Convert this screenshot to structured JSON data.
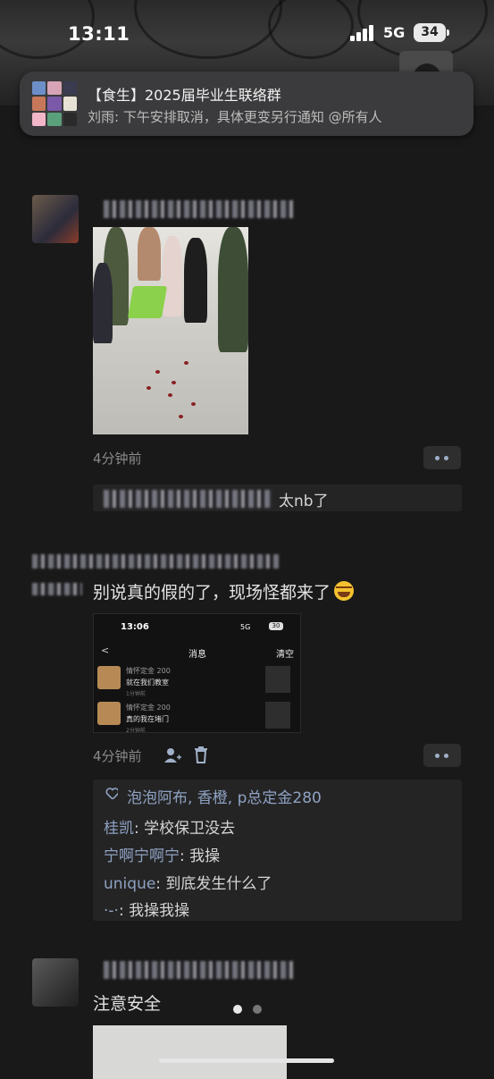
{
  "status": {
    "time": "13:11",
    "network": "5G",
    "battery": "34"
  },
  "notification": {
    "group_title": "【食生】2025届毕业生联络群",
    "message": "刘雨: 下午安排取消，具体更变另行通知 @所有人"
  },
  "posts": [
    {
      "time": "4分钟前",
      "comment": "太nb了",
      "image_kind": "photo"
    },
    {
      "text": "别说真的假的了，现场怪都来了",
      "emoji": "face-with-tears-of-joy",
      "time": "4分钟前",
      "likes": "泡泡阿布, 香橙, p总定金280",
      "comments": [
        {
          "name": "桂凯",
          "text": ": 学校保卫没去"
        },
        {
          "name": "宁啊宁啊宁",
          "text": ": 我操"
        },
        {
          "name": "unique",
          "text": ": 到底发生什么了"
        },
        {
          "name": "·-·",
          "text": ": 我操我操"
        }
      ],
      "screenshot": {
        "time": "13:06",
        "network": "5G",
        "battery": "30",
        "title": "消息",
        "clear": "清空",
        "rows": [
          {
            "name": "情怀定金 200",
            "text": "就在我们教室",
            "time": "1分钟前"
          },
          {
            "name": "情怀定金 200",
            "text": "真的我在堵门",
            "time": "2分钟前"
          }
        ]
      }
    },
    {
      "text": "注意安全"
    }
  ],
  "colors": {
    "background": "#191919",
    "card": "#242424",
    "name_blue": "#8fa2c3",
    "banner": "#3b3b3d"
  }
}
